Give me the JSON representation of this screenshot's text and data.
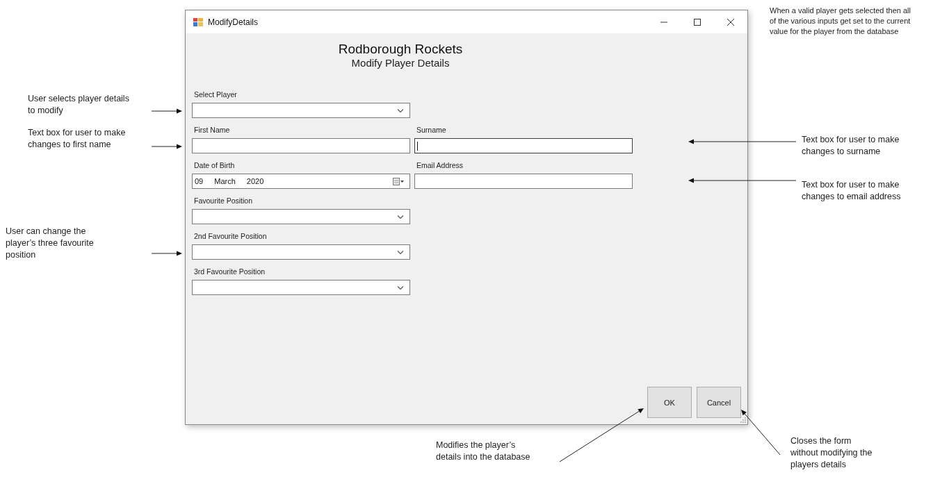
{
  "window": {
    "title": "ModifyDetails"
  },
  "header": {
    "title": "Rodborough Rockets",
    "subtitle": "Modify Player Details"
  },
  "rows": [
    [
      {
        "kind": "combo",
        "label": "Select Player",
        "focused": false
      }
    ],
    [
      {
        "kind": "text",
        "label": "First Name",
        "focused": false
      },
      {
        "kind": "text",
        "label": "Surname",
        "focused": true
      }
    ],
    [
      {
        "kind": "date",
        "label": "Date of Birth",
        "parts": [
          "09",
          "March",
          "2020"
        ],
        "focused": false
      },
      {
        "kind": "text",
        "label": "Email Address",
        "focused": false
      }
    ],
    [
      {
        "kind": "combo",
        "label": "Favourite Position",
        "focused": false
      }
    ],
    [
      {
        "kind": "combo",
        "label": "2nd Favourite Position",
        "focused": false
      }
    ],
    [
      {
        "kind": "combo",
        "label": "3rd Favourite Position",
        "focused": false
      }
    ]
  ],
  "buttons": [
    {
      "label": "OK"
    },
    {
      "label": "Cancel"
    }
  ],
  "annotations": [
    {
      "text": "User selects player details to modify"
    },
    {
      "text": "Text box for user to make changes to first name"
    },
    {
      "text": "User can change the player’s three favourite position"
    },
    {
      "text": "When a valid player gets selected then all of the various inputs get set to the current value for the player from the database"
    },
    {
      "text": "Text box for user to make changes to surname"
    },
    {
      "text": "Text box for user to make changes to email address"
    },
    {
      "text": "Modifies the player’s details into the database"
    },
    {
      "text": "Closes the form without  modifying the players details"
    }
  ]
}
